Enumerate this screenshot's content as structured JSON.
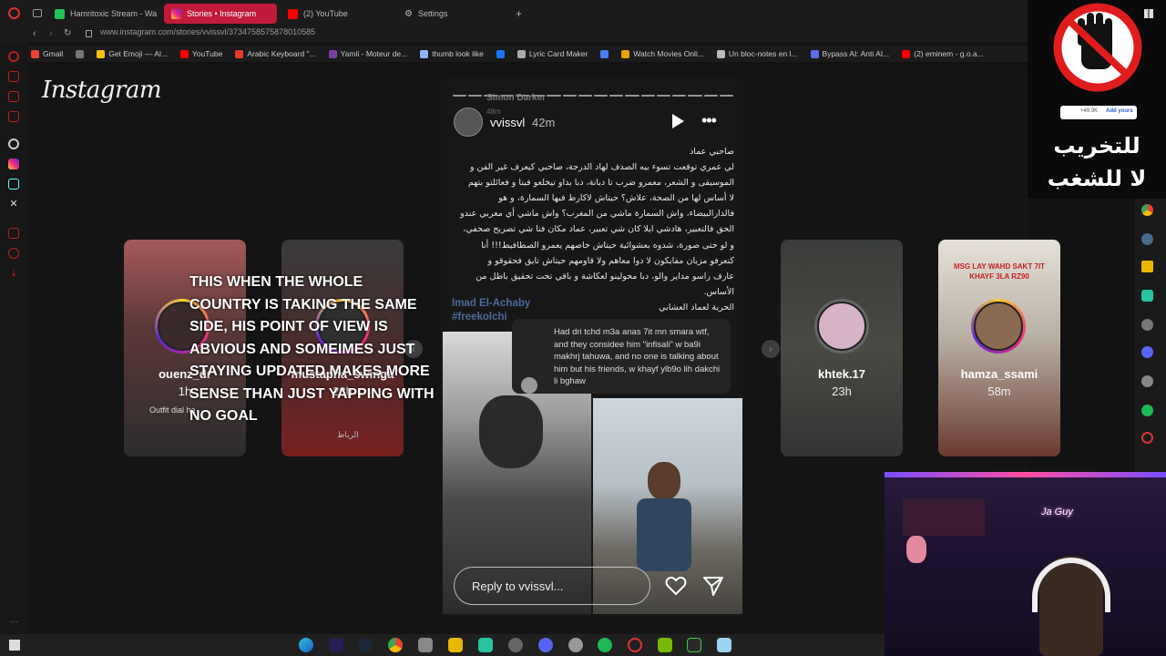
{
  "browser": {
    "tabs": [
      {
        "label": "Hamritoxic Stream - Watc",
        "color": "#21c45a"
      },
      {
        "label": "Stories • Instagram",
        "color": "#e1306c"
      },
      {
        "label": "(2) YouTube",
        "color": "#ff0000"
      },
      {
        "label": "Settings",
        "color": "#888888"
      }
    ],
    "new_tab_label": "+",
    "url": "www.instagram.com/stories/vvissvl/3734758575878010585",
    "bookmarks": [
      {
        "label": "Gmail",
        "color": "#ea4335"
      },
      {
        "label": "",
        "color": "#777777"
      },
      {
        "label": "Get Emoji — Al...",
        "color": "#f4c20d"
      },
      {
        "label": "YouTube",
        "color": "#ff0000"
      },
      {
        "label": "Arabic Keyboard \"...",
        "color": "#e33b2e"
      },
      {
        "label": "Yamli - Moteur de...",
        "color": "#7b3fa0"
      },
      {
        "label": "thumb look like",
        "color": "#8fb4ff"
      },
      {
        "label": "",
        "color": "#1877f2"
      },
      {
        "label": "Lyric Card Maker",
        "color": "#aaaaaa"
      },
      {
        "label": "",
        "color": "#4a7cf3"
      },
      {
        "label": "Watch Movies Onli...",
        "color": "#e8a300"
      },
      {
        "label": "Un bloc-notes en l...",
        "color": "#bbbbbb"
      },
      {
        "label": "Bypass AI: Anti AI...",
        "color": "#5b6cf0"
      },
      {
        "label": "(2) eminem - g.o.a...",
        "color": "#ff0000"
      }
    ]
  },
  "instagram": {
    "logo": "Instagram",
    "side_stories": [
      {
        "username": "ouenz_dr",
        "time": "1h"
      },
      {
        "username": "mustapha_swinga",
        "time": "23h"
      },
      {
        "username": "khtek.17",
        "time": "23h"
      },
      {
        "username": "hamza_ssami",
        "time": "58m"
      }
    ],
    "card1_caption": "Outfit dial ha",
    "card2_caption": "الرباط",
    "card4_caption": "MSG LAY WAHD SAKT 7IT KHAYF 3LA RZ90",
    "overlay_caption": "THIS WHEN THE WHOLE COUNTRY IS TAKING THE SAME SIDE, HIS POINT OF VIEW IS ABVIOUS AND SOMEIMES JUST STAYING UPDATED MAKES MORE SENSE THAN JUST YAPPING WITH NO GOAL",
    "prev_arrow": "‹",
    "next_arrow": "›",
    "main_story": {
      "username": "vvissvl",
      "age": "42m",
      "shared_author": "Simon Darker",
      "shared_age": "48m",
      "post_lines": [
        "صاحبي عماد",
        "لي عمري توقعت تسوء بيه الصدف لهاد الدرجة، صاحبي كيعرف غير الفن و",
        "الموسيقى و الشعر، معمرو ضرب تا دبانة، دبا بداو تيخلعو فينا و فعائلتو بتهم",
        "لا أساس لها من الصحة، علاش؟ حيتاش لاكارط فيها السمارة، و هو",
        "فالدارالبيضاء، واش السمارة ماشي من المغرب؟ واش ماشي أي مغربي عندو",
        "الحق فالتعبير، هادشي ايلا كان شي تعبير، عماد مكان فتا شي تصريح صحفي،",
        "و لو حتى صورة، شدوه بعشوائية حيتاش خاصهم يعمرو الصطافيط!!! أنا",
        "كنعرفو مزيان مفايكون لا دوا معاهم ولا قاومهم حيتاش تايق فحقوقو و",
        "عارف راسو مداير والو، دبا محولينو لعكاشة و باقي تحت تحقيق باطل من",
        "الأساس.",
        "الحرية لعماد العشابي"
      ],
      "hashtags": [
        "Imad El-Achaby",
        "#freekolchi"
      ],
      "comment": "Had dri tchd m3a anas 7it mn smara wtf, and they considee him \"infisali\" w ba9i makhrj tahuwa, and no one is talking about him but his friends, w khayf ylb9o lih dakchi li bghaw",
      "reply_placeholder": "Reply to vvissvl...",
      "progress_segments": 18
    }
  },
  "overlay": {
    "arabic_line1": "للتخريب",
    "arabic_line2": "لا للشغب",
    "mini_badge": "+49.9K",
    "mini_button": "Add yours"
  },
  "webcam": {
    "neon_sign": "Ja Guy"
  },
  "colors": {
    "accent": "#c21a3a",
    "instagram_gradient_start": "#f9ce34",
    "instagram_gradient_end": "#6228d7",
    "hashtag": "#4a6a9d"
  }
}
